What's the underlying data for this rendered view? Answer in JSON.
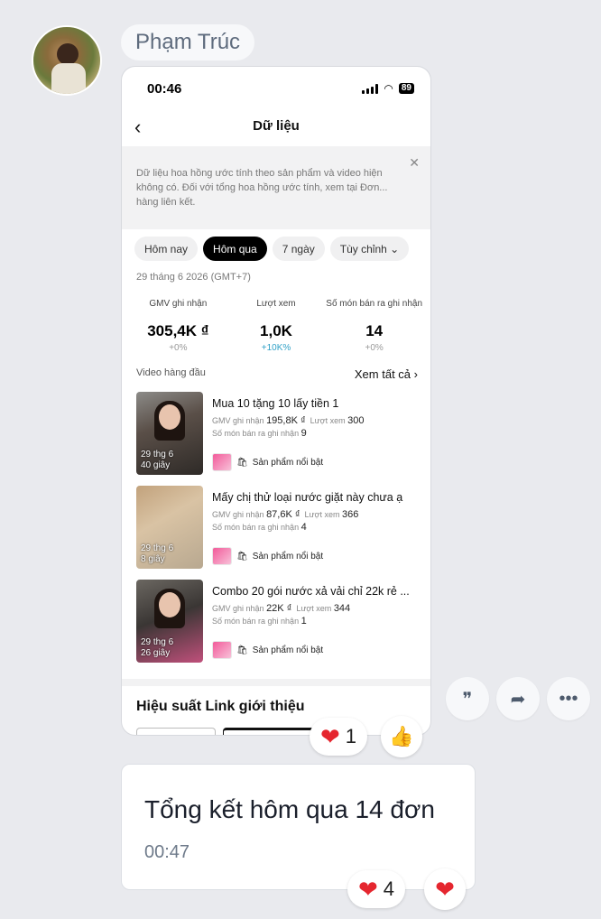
{
  "sender": {
    "name": "Phạm Trúc"
  },
  "screenshot": {
    "status_time": "00:46",
    "battery": "89",
    "title": "Dữ liệu",
    "notice": "Dữ liệu hoa hồng ước tính theo sản phẩm và video hiện không có. Đối với tổng hoa hồng ước tính, xem tại Đơn... hàng liên kết.",
    "chips": [
      "Hôm nay",
      "Hôm qua",
      "7 ngày",
      "Tùy chỉnh ⌄"
    ],
    "date": "29 tháng 6 2026 (GMT+7)",
    "metrics": [
      {
        "label": "GMV ghi nhận",
        "value": "305,4K ₫",
        "delta": "+0%"
      },
      {
        "label": "Lượt xem",
        "value": "1,0K",
        "delta": "+10K%"
      },
      {
        "label": "Số món bán ra ghi nhận",
        "value": "14",
        "delta": "+0%"
      }
    ],
    "top_videos_label": "Video hàng đầu",
    "see_all": "Xem tất cả",
    "videos": [
      {
        "title": "Mua 10 tặng 10 lấy tiền 1",
        "gmv_label": "GMV ghi nhận",
        "gmv": "195,8K ₫",
        "views_label": "Lượt xem",
        "views": "300",
        "sold_label": "Số món bán ra ghi nhận",
        "sold": "9",
        "date": "29 thg 6",
        "duration": "40 giây",
        "product": "Sản phẩm nổi bật"
      },
      {
        "title": "Mấy chị thử loại nước giặt này chưa ạ",
        "gmv_label": "GMV ghi nhận",
        "gmv": "87,6K ₫",
        "views_label": "Lượt xem",
        "views": "366",
        "sold_label": "Số món bán ra ghi nhận",
        "sold": "4",
        "date": "29 thg 6",
        "duration": "8 giây",
        "product": "Sản phẩm nổi bật"
      },
      {
        "title": "Combo 20 gói nước xả vải chỉ 22k rẻ ...",
        "gmv_label": "GMV ghi nhận",
        "gmv": "22K ₫",
        "views_label": "Lượt xem",
        "views": "344",
        "sold_label": "Số món bán ra ghi nhận",
        "sold": "1",
        "date": "29 thg 6",
        "duration": "26 giây",
        "product": "Sản phẩm nổi bật"
      }
    ],
    "section_title": "Hiệu suất Link giới thiệu"
  },
  "reactions_image": {
    "heart_count": "1"
  },
  "message": {
    "text": "Tổng kết hôm qua 14 đơn",
    "time": "00:47"
  },
  "reactions_message": {
    "heart_count": "4"
  }
}
